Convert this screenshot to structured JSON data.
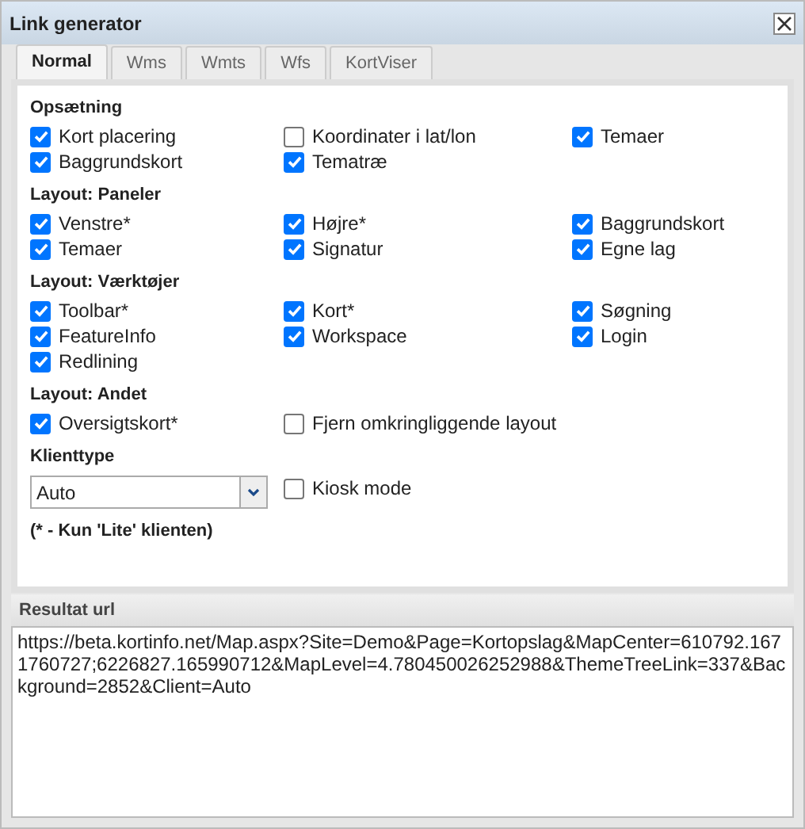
{
  "window": {
    "title": "Link generator"
  },
  "tabs": [
    {
      "label": "Normal",
      "selected": true
    },
    {
      "label": "Wms",
      "selected": false
    },
    {
      "label": "Wmts",
      "selected": false
    },
    {
      "label": "Wfs",
      "selected": false
    },
    {
      "label": "KortViser",
      "selected": false
    }
  ],
  "sections": [
    {
      "title": "Opsætning",
      "items": [
        {
          "label": "Kort placering",
          "checked": true
        },
        {
          "label": "Koordinater i lat/lon",
          "checked": false
        },
        {
          "label": "Temaer",
          "checked": true
        },
        {
          "label": "Baggrundskort",
          "checked": true
        },
        {
          "label": "Tematræ",
          "checked": true
        }
      ]
    },
    {
      "title": "Layout: Paneler",
      "items": [
        {
          "label": "Venstre*",
          "checked": true
        },
        {
          "label": "Højre*",
          "checked": true
        },
        {
          "label": "Baggrundskort",
          "checked": true
        },
        {
          "label": "Temaer",
          "checked": true
        },
        {
          "label": "Signatur",
          "checked": true
        },
        {
          "label": "Egne lag",
          "checked": true
        }
      ]
    },
    {
      "title": "Layout: Værktøjer",
      "items": [
        {
          "label": "Toolbar*",
          "checked": true
        },
        {
          "label": "Kort*",
          "checked": true
        },
        {
          "label": "Søgning",
          "checked": true
        },
        {
          "label": "FeatureInfo",
          "checked": true
        },
        {
          "label": "Workspace",
          "checked": true
        },
        {
          "label": "Login",
          "checked": true
        },
        {
          "label": "Redlining",
          "checked": true
        }
      ]
    },
    {
      "title": "Layout: Andet",
      "items": [
        {
          "label": "Oversigtskort*",
          "checked": true
        },
        {
          "label": "Fjern omkringliggende layout",
          "checked": false
        }
      ]
    }
  ],
  "client_type": {
    "title": "Klienttype",
    "select": {
      "value": "Auto"
    },
    "kiosk": {
      "label": "Kiosk mode",
      "checked": false
    }
  },
  "note": "(* - Kun 'Lite' klienten)",
  "result": {
    "title": "Resultat url",
    "value": "https://beta.kortinfo.net/Map.aspx?Site=Demo&Page=Kortopslag&MapCenter=610792.1671760727;6226827.165990712&MapLevel=4.780450026252988&ThemeTreeLink=337&Background=2852&Client=Auto"
  }
}
